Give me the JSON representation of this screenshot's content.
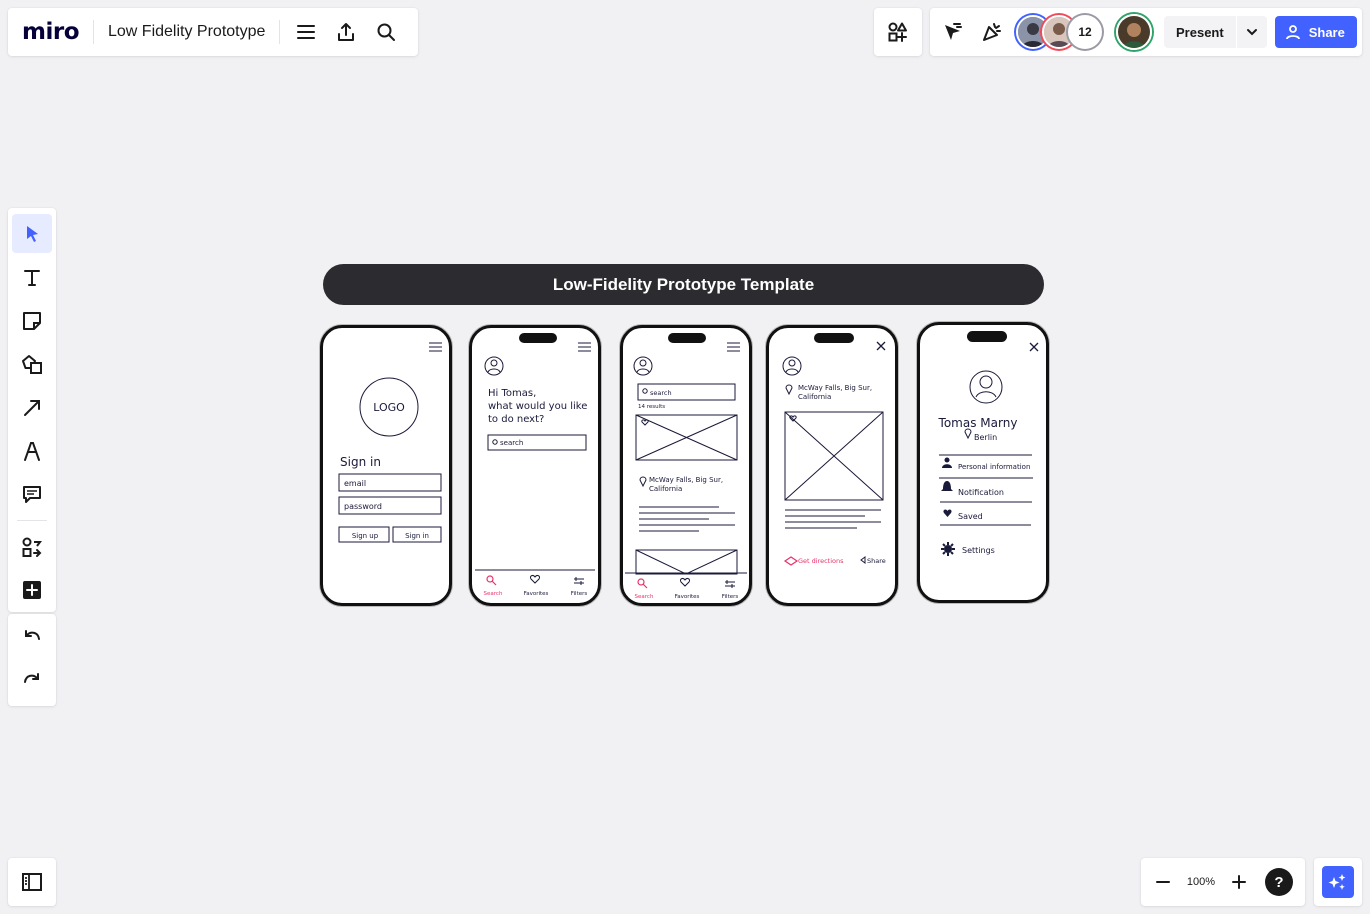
{
  "app": {
    "logo": "miro",
    "board_title": "Low Fidelity Prototype"
  },
  "header": {
    "collaborator_count": "12",
    "present_label": "Present",
    "share_label": "Share"
  },
  "zoom": {
    "level": "100%"
  },
  "help_label": "?",
  "canvas": {
    "banner_title": "Low-Fidelity Prototype Template",
    "screens": {
      "signin": {
        "logo_text": "LOGO",
        "heading": "Sign in",
        "email": "email",
        "password": "password",
        "signup_btn": "Sign up",
        "signin_btn": "Sign in"
      },
      "home": {
        "greeting_1": "Hi Tomas,",
        "greeting_2": "what would you like",
        "greeting_3": "to do next?",
        "search": "search",
        "nav_search": "Search",
        "nav_favorites": "Favorites",
        "nav_filters": "Filters"
      },
      "results": {
        "search": "search",
        "results_count": "14 results",
        "location_1": "McWay Falls, Big Sur,",
        "location_2": "California",
        "nav_search": "Search",
        "nav_favorites": "Favorites",
        "nav_filters": "Filters"
      },
      "detail": {
        "location_1": "McWay Falls, Big Sur,",
        "location_2": "California",
        "get_directions": "Get directions",
        "share": "Share"
      },
      "profile": {
        "name": "Tomas Marny",
        "city": "Berlin",
        "item_1": "Personal information",
        "item_2": "Notification",
        "item_3": "Saved",
        "item_4": "Settings"
      }
    }
  },
  "colors": {
    "accent": "#4262ff",
    "banner": "#2b2b30",
    "sketch_pink": "#e8336b",
    "canvas": "#f1f1f4"
  },
  "icons": {
    "toolbar": [
      "select-cursor-icon",
      "text-icon",
      "sticky-note-icon",
      "shapes-icon",
      "arrow-line-icon",
      "pen-icon",
      "comment-icon",
      "templates-icon",
      "add-more-icon"
    ]
  }
}
